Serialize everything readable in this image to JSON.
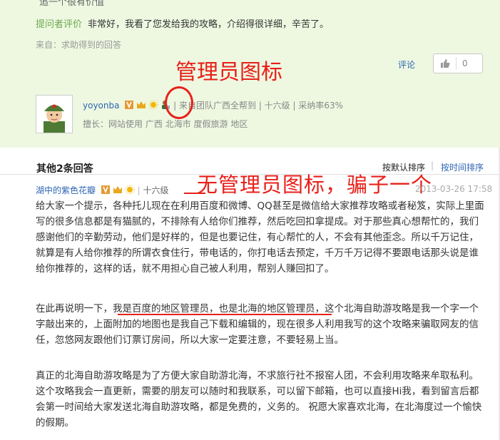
{
  "best_answer": {
    "top_cut_text": "追一个很有价值",
    "asker_tag": "提问者评价",
    "asker_comment": "非常好，我看了您发给我的攻略，介绍得很详细，辛苦了。",
    "from_text": "来自：求助得到的回答",
    "comment_link": "评论",
    "like_count": "0",
    "username": "yoyonba",
    "team_info": "来自团队广西全帮到",
    "level": "十六级",
    "adopt_rate": "采纳率63%",
    "specialty_label": "擅长：",
    "specialties": [
      "网站使用",
      "广西",
      "北海市",
      "度假旅游",
      "地区"
    ]
  },
  "annotations": {
    "admin_icon": "管理员图标",
    "no_admin_icon": "无管理员图标，骗子一个"
  },
  "other_answers": {
    "title": "其他2条回答",
    "sort_default": "按默认排序",
    "sort_time": "按时间排序",
    "separator": "|",
    "username": "湖中的紫色花瓣",
    "level": "十六级",
    "date": "2013-03-26 17:58",
    "paragraphs": [
      "给大家一个提示，各种托儿现在在利用百度和微博、QQ甚至是微信给大家推荐攻略或者秘笈，实际上里面写的很多信息都是有猫腻的，不排除有人给你们推荐，然后吃回扣拿提成。对于那些真心想帮忙的，我们感谢他们的辛勤劳动，他们是好样的，但是也要记住，有心帮忙的人，不会有其他歪念。所以千万记住，就算是有人给你推荐的所谓衣食住行，带电话的，你打电话去预定，千万千万记得不要跟电话那头说是谁给你推荐的，这样的话，就不用担心自己被人利用，帮别人赚回扣了。",
      "在此再说明一下，我是百度的地区管理员，也是北海的地区管理员，这个北海自助游攻略是我一个字一个字敲出来的，上面附加的地图也是我自己下载和编辑的，现在很多人利用我写的这个攻略来骗取网友的信任，忽悠网友跟他们订票订房间，所以大家一定要注意，不要轻易上当。",
      "真正的北海自助游攻略是为了方便大家自助游北海，不求旅行社不报窑人团，不会利用攻略来牟取私利。这个攻略我会一直更新，需要的朋友可以随时和我联系，可以留下邮箱，也可以直接Hi我，看到留言后都会第一时间给大家发送北海自助游攻略，都是免费的，义务的。 祝愿大家喜欢北海，在北海度过一个愉快的假期。"
    ]
  },
  "colors": {
    "link": "#2d64b3",
    "annotation": "#e8201a",
    "best_bg": "#eef8e1"
  },
  "icons": [
    "medal-icon",
    "crown-icon",
    "sun-icon",
    "admin-icon",
    "thumb-up-icon",
    "avatar-soldier"
  ]
}
